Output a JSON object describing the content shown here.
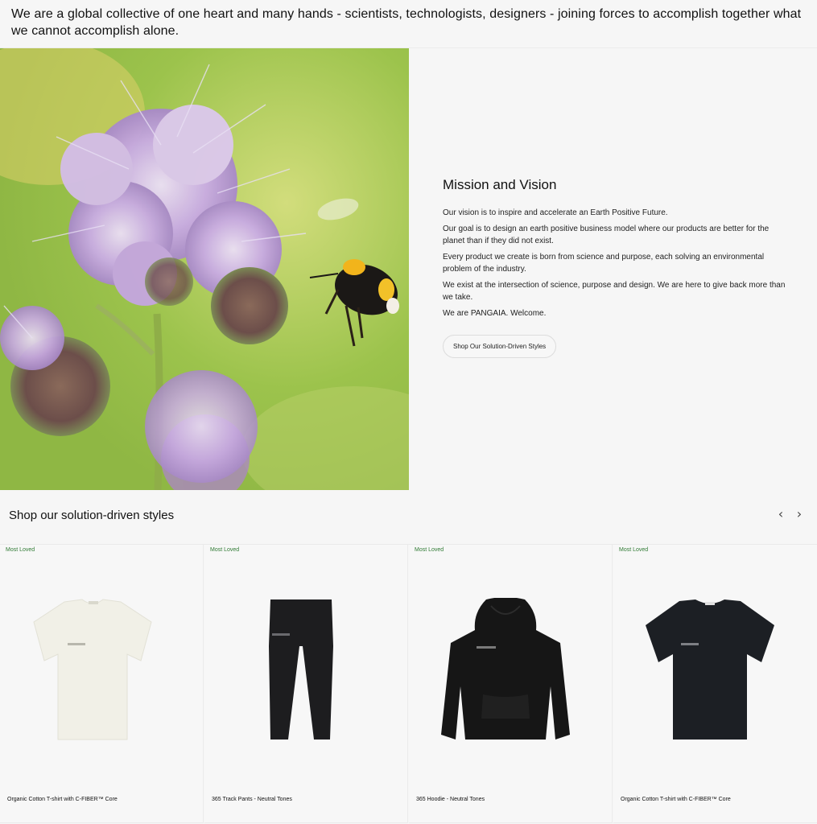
{
  "intro": {
    "text": "We are a global collective of one heart and many hands - scientists, technologists, designers - joining forces to accomplish together what we cannot accomplish alone."
  },
  "mission": {
    "title": "Mission and Vision",
    "paragraphs": [
      "Our vision is to inspire and accelerate an Earth Positive Future.",
      "Our goal is to design an earth positive business model where our products are better for the planet than if they did not exist.",
      "Every product we create is born from science and purpose, each solving an environmental problem of the industry.",
      "We exist at the intersection of science, purpose and design. We are here to give back more than we take.",
      "We are PANGAIA. Welcome."
    ],
    "cta_label": "Shop Our Solution-Driven Styles"
  },
  "hero": {
    "image": "bee-on-purple-phacelia-flower"
  },
  "products_section": {
    "title": "Shop our solution-driven styles",
    "prev_icon": "‹",
    "next_icon": "›",
    "items": [
      {
        "badge": "Most Loved",
        "name": "Organic Cotton T-shirt with C-FIBER™ Core",
        "image": "off-white-tshirt"
      },
      {
        "badge": "Most Loved",
        "name": "365 Track Pants - Neutral Tones",
        "image": "black-track-pants"
      },
      {
        "badge": "Most Loved",
        "name": "365 Hoodie - Neutral Tones",
        "image": "black-hoodie"
      },
      {
        "badge": "Most Loved",
        "name": "Organic Cotton T-shirt with C-FIBER™ Core",
        "image": "black-tshirt"
      }
    ]
  },
  "colors": {
    "background": "#f6f6f6",
    "badge_green": "#2f7a33",
    "text": "#111111"
  }
}
